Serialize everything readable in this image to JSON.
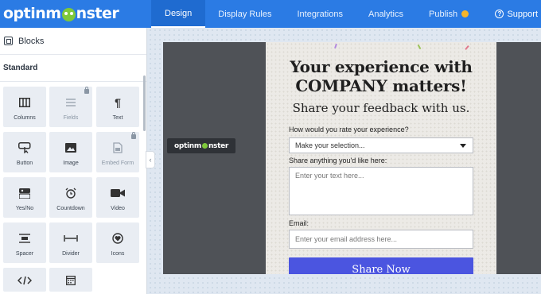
{
  "brand": {
    "logo_text_left": "optinm",
    "logo_text_right": "nster",
    "accent": "#2b7be4",
    "logo_mark_color": "#7ec83a"
  },
  "nav": {
    "tabs": [
      {
        "label": "Design",
        "active": true
      },
      {
        "label": "Display Rules",
        "active": false
      },
      {
        "label": "Integrations",
        "active": false
      },
      {
        "label": "Analytics",
        "active": false
      },
      {
        "label": "Publish",
        "active": false
      }
    ],
    "support_label": "Support",
    "support_icon": "question-circle-icon",
    "publish_badge_color": "#f7b52a"
  },
  "sidebar": {
    "header": "Blocks",
    "header_icon": "blocks-icon",
    "section": "Standard",
    "tiles": [
      {
        "label": "Columns",
        "icon": "columns-icon",
        "locked": false
      },
      {
        "label": "Fields",
        "icon": "fields-icon",
        "locked": true
      },
      {
        "label": "Text",
        "icon": "paragraph-icon",
        "locked": false
      },
      {
        "label": "Button",
        "icon": "button-pointer-icon",
        "locked": false
      },
      {
        "label": "Image",
        "icon": "image-icon",
        "locked": false
      },
      {
        "label": "Embed Form",
        "icon": "embed-form-icon",
        "locked": true
      },
      {
        "label": "Yes/No",
        "icon": "yes-no-icon",
        "locked": false
      },
      {
        "label": "Countdown",
        "icon": "alarm-clock-icon",
        "locked": false
      },
      {
        "label": "Video",
        "icon": "video-camera-icon",
        "locked": false
      },
      {
        "label": "Spacer",
        "icon": "spacer-icon",
        "locked": false
      },
      {
        "label": "Divider",
        "icon": "divider-icon",
        "locked": false
      },
      {
        "label": "Icons",
        "icon": "heart-circle-icon",
        "locked": false
      },
      {
        "label": "",
        "icon": "code-icon",
        "locked": false
      },
      {
        "label": "",
        "icon": "calendar-grid-icon",
        "locked": false
      }
    ]
  },
  "canvas": {
    "side_logo_left": "optinm",
    "side_logo_right": "nster",
    "popup": {
      "title": "Your experience with COMPANY matters!",
      "subtitle": "Share your feedback with us.",
      "rating_label": "How would you rate your experience?",
      "rating_value": "Make your selection...",
      "comment_label": "Share anything you'd like here:",
      "comment_placeholder": "Enter your text here...",
      "email_label": "Email:",
      "email_placeholder": "Enter your email address here...",
      "submit_label": "Share Now",
      "submit_color": "#4b55e0"
    }
  }
}
